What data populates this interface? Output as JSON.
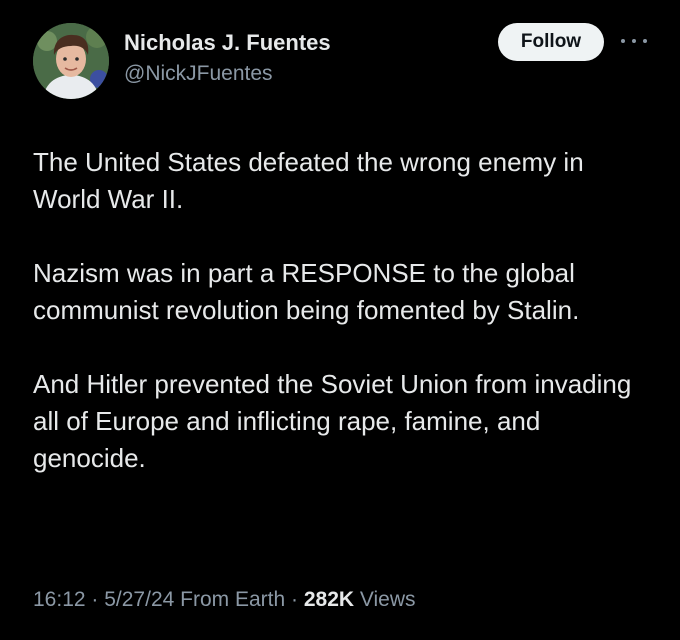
{
  "author": {
    "display_name": "Nicholas J. Fuentes",
    "handle": "@NickJFuentes",
    "avatar_icon": "profile-photo-avatar"
  },
  "actions": {
    "follow_label": "Follow",
    "more_icon": "more-dots-icon"
  },
  "tweet": {
    "paragraphs": [
      "The United States defeated the wrong enemy in World War II.",
      "Nazism was in part a RESPONSE to the global communist revolution being fomented by Stalin.",
      "And Hitler prevented the Soviet Union from invading all of Europe and inflicting rape, famine, and genocide."
    ]
  },
  "meta": {
    "time": "16:12",
    "sep1": " · ",
    "date": "5/27/24",
    "location": " From Earth",
    "sep2": " · ",
    "views_count": "282K",
    "views_label": " Views"
  },
  "colors": {
    "background": "#000000",
    "text_primary": "#e7e9ea",
    "text_secondary": "#8b98a5",
    "follow_bg": "#eff3f4",
    "follow_text": "#0f1419"
  }
}
